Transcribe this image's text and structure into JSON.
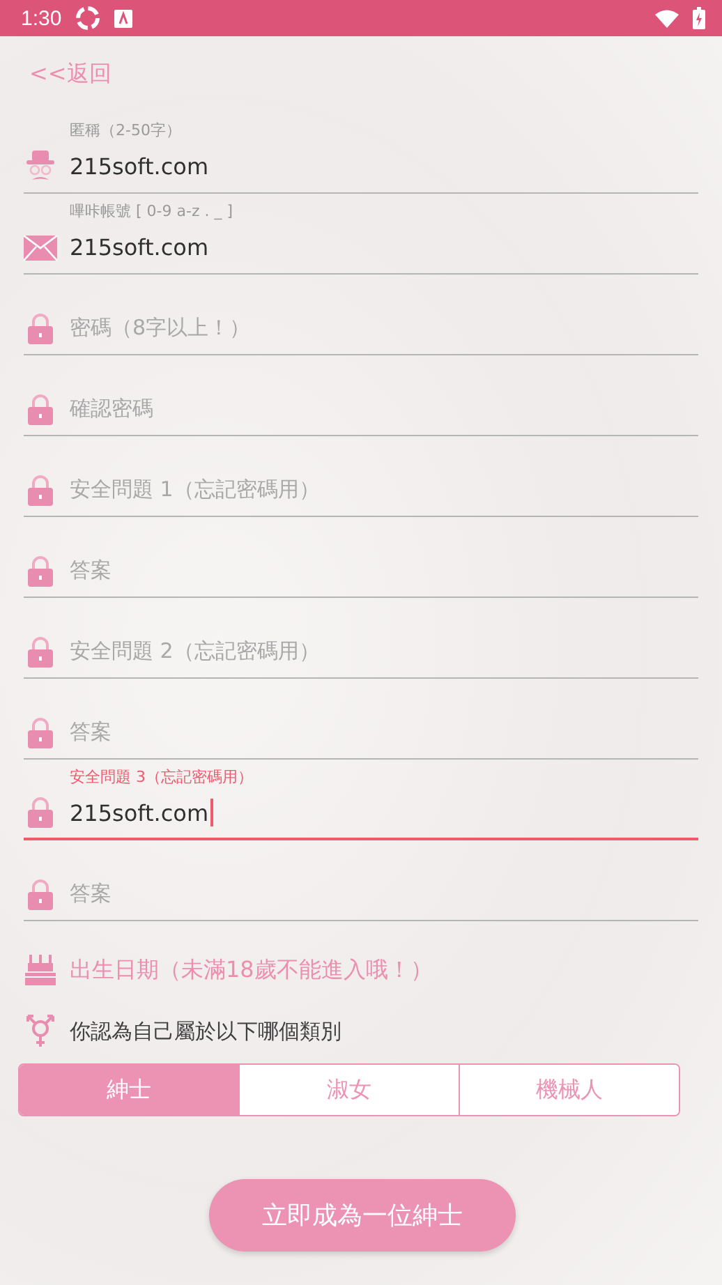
{
  "status_bar": {
    "time": "1:30"
  },
  "back_link": "<<返回",
  "fields": [
    {
      "kind": "nickname",
      "label": "匿稱（2-50字）",
      "value": "215soft.com",
      "focused": false
    },
    {
      "kind": "account",
      "label": "嗶咔帳號 [ 0-9 a-z . _ ]",
      "value": "215soft.com",
      "focused": false
    },
    {
      "kind": "secret",
      "placeholder": "密碼（8字以上！）",
      "focused": false
    },
    {
      "kind": "secret",
      "placeholder": "確認密碼",
      "focused": false
    },
    {
      "kind": "secret",
      "placeholder": "安全問題 1（忘記密碼用）",
      "focused": false
    },
    {
      "kind": "secret",
      "placeholder": "答案",
      "focused": false
    },
    {
      "kind": "secret",
      "placeholder": "安全問題 2（忘記密碼用）",
      "focused": false
    },
    {
      "kind": "secret",
      "placeholder": "答案",
      "focused": false
    },
    {
      "kind": "secret",
      "label": "安全問題 3（忘記密碼用）",
      "value": "215soft.com",
      "focused": true
    },
    {
      "kind": "secret",
      "placeholder": "答案",
      "focused": false
    }
  ],
  "birthday": "出生日期（未滿18歲不能進入哦！）",
  "gender_prompt": "你認為自己屬於以下哪個類別",
  "gender_options": [
    {
      "label": "紳士",
      "selected": true
    },
    {
      "label": "淑女",
      "selected": false
    },
    {
      "label": "機械人",
      "selected": false
    }
  ],
  "submit_button": "立即成為一位紳士"
}
